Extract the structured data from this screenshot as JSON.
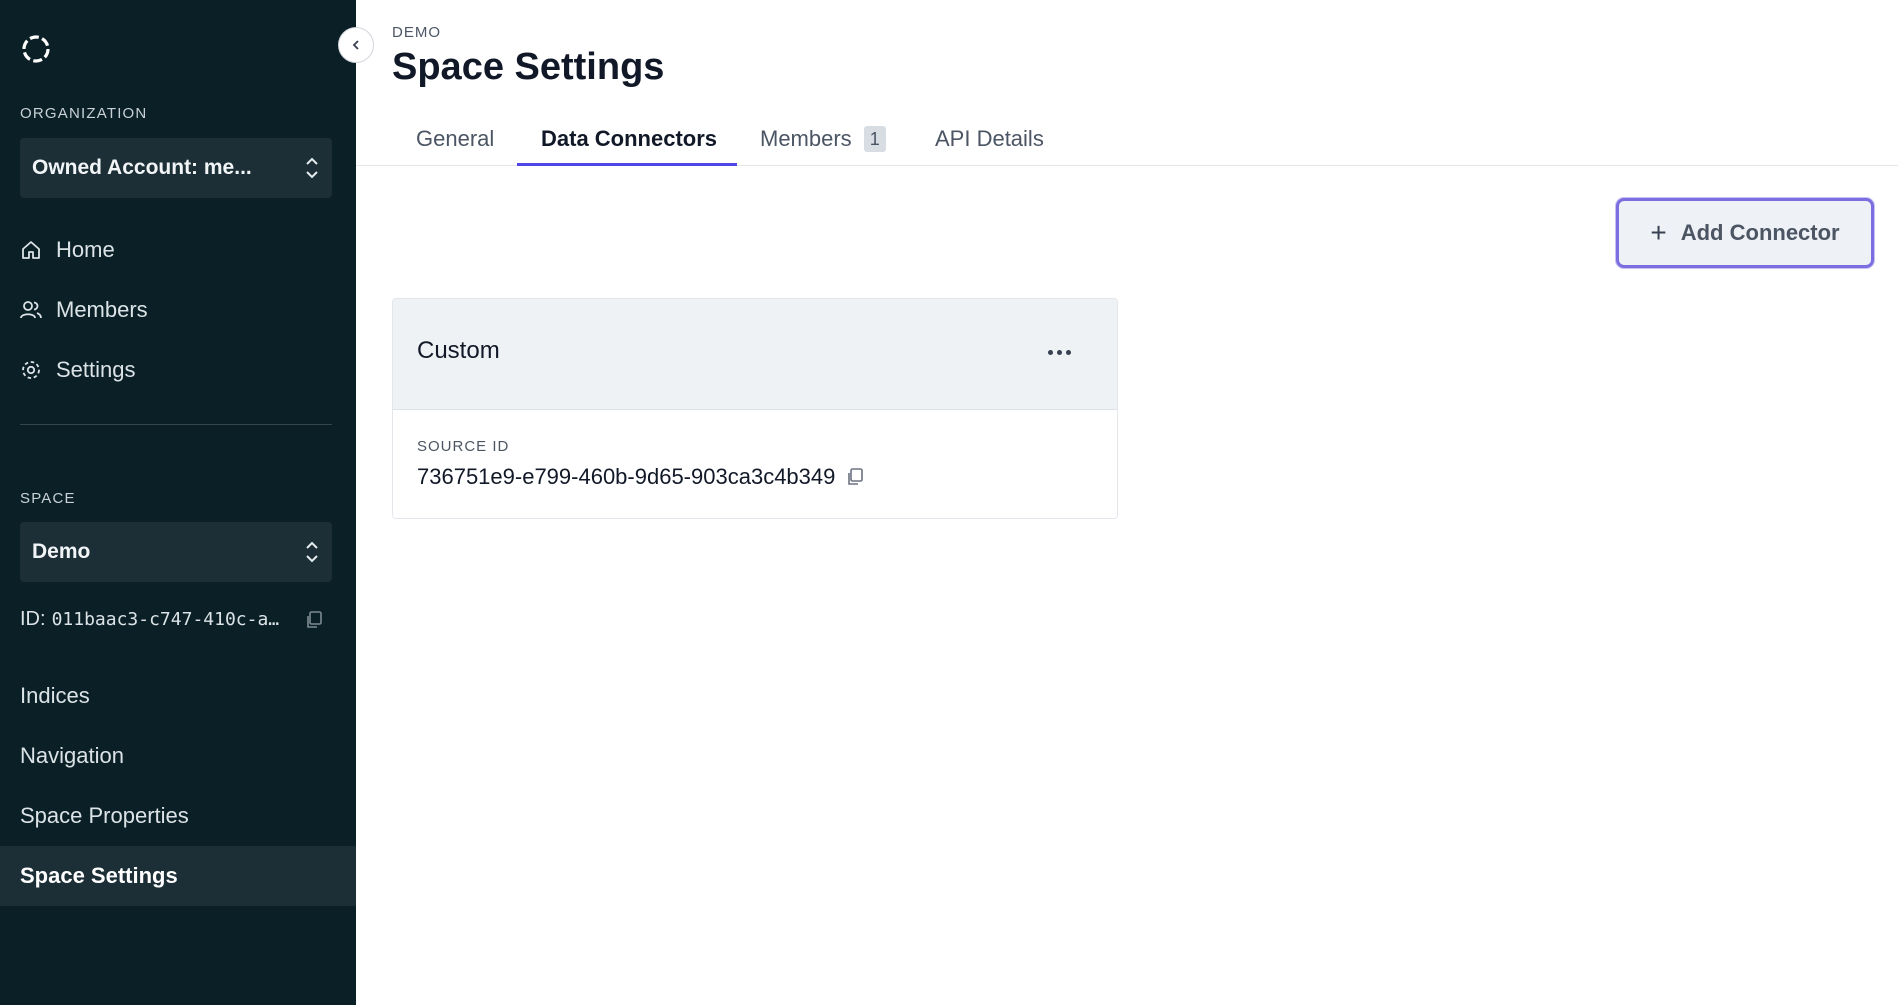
{
  "sidebar": {
    "organization_label": "ORGANIZATION",
    "organization_value": "Owned Account: me...",
    "nav": {
      "home": "Home",
      "members": "Members",
      "settings": "Settings"
    },
    "space_label": "SPACE",
    "space_value": "Demo",
    "space_id_label": "ID:",
    "space_id_value": "011baac3-c747-410c-a…",
    "space_nav": {
      "indices": "Indices",
      "navigation": "Navigation",
      "space_properties": "Space Properties",
      "space_settings": "Space Settings"
    }
  },
  "main": {
    "breadcrumb": "DEMO",
    "title": "Space Settings",
    "tabs": {
      "general": "General",
      "data_connectors": "Data Connectors",
      "members": "Members",
      "members_count": "1",
      "api_details": "API Details"
    },
    "add_button": "Add Connector",
    "connector": {
      "title": "Custom",
      "source_label": "SOURCE ID",
      "source_value": "736751e9-e799-460b-9d65-903ca3c4b349"
    }
  },
  "colors": {
    "sidebar_bg": "#0b1f26",
    "accent": "#4f46e5",
    "button_focus": "#7c6ee0"
  }
}
